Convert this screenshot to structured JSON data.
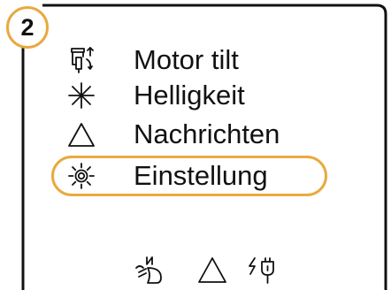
{
  "step": {
    "number": "2",
    "accent_color": "#e9a93f"
  },
  "menu": {
    "items": [
      {
        "label": "Motor tilt",
        "icon": "motor-tilt-icon",
        "selected": false
      },
      {
        "label": "Helligkeit",
        "icon": "brightness-icon",
        "selected": false
      },
      {
        "label": "Nachrichten",
        "icon": "warning-triangle-icon",
        "selected": false
      },
      {
        "label": "Einstellung",
        "icon": "settings-sun-icon",
        "selected": true
      }
    ]
  },
  "status_bar": {
    "icons": [
      "north-headlight-icon",
      "warning-triangle-icon",
      "charging-plug-icon"
    ]
  }
}
